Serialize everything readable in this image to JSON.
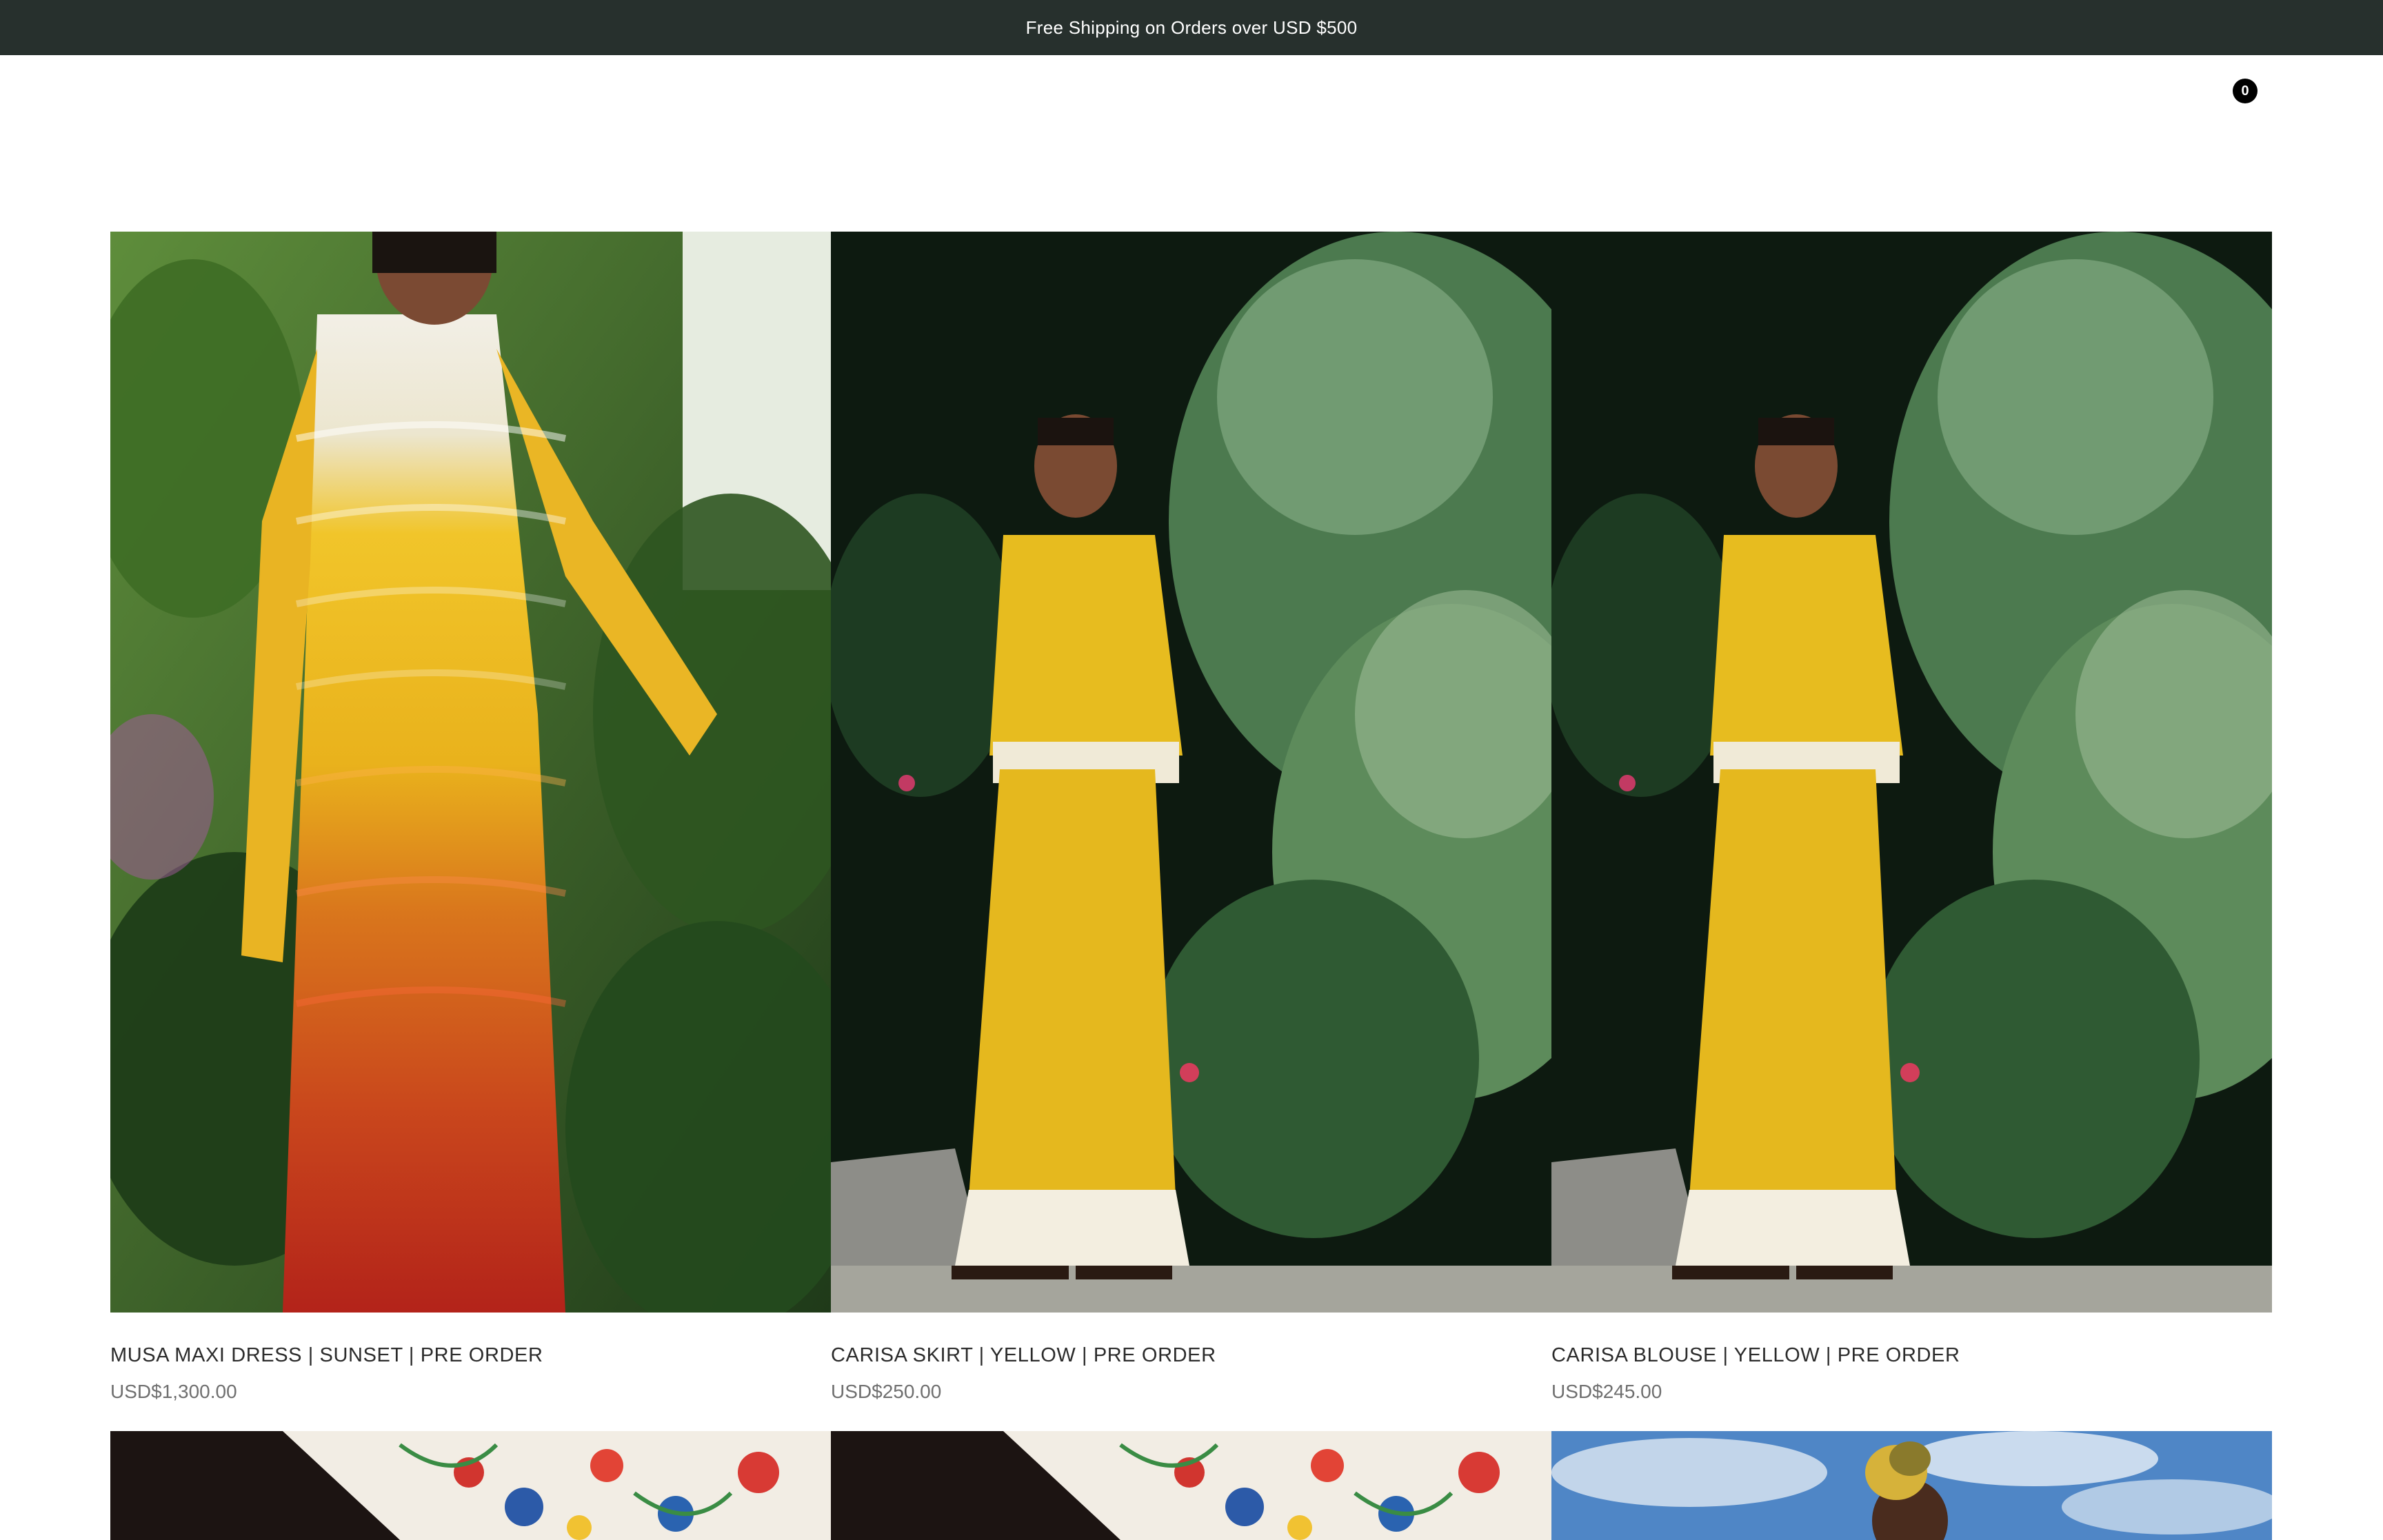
{
  "announcement": "Free Shipping on Orders over USD $500",
  "cart": {
    "count": "0"
  },
  "products": [
    {
      "title": "MUSA MAXI DRESS | SUNSET | PRE ORDER",
      "price": "USD$1,300.00"
    },
    {
      "title": "CARISA SKIRT | YELLOW | PRE ORDER",
      "price": "USD$250.00"
    },
    {
      "title": "CARISA BLOUSE | YELLOW | PRE ORDER",
      "price": "USD$245.00"
    }
  ]
}
